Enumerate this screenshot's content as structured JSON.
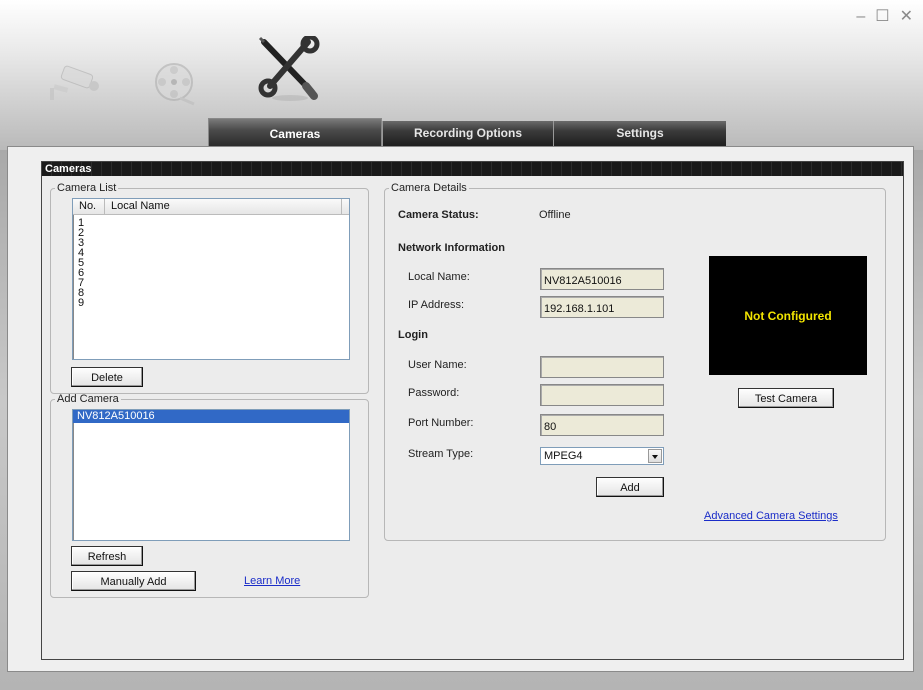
{
  "window": {
    "controls": {
      "minimize": "–",
      "maximize": "☐",
      "close": "✕"
    }
  },
  "mode_icons": [
    "camera-icon",
    "film-reel-icon",
    "tools-icon"
  ],
  "tabs": [
    {
      "label": "Cameras",
      "active": true
    },
    {
      "label": "Recording Options",
      "active": false
    },
    {
      "label": "Settings",
      "active": false
    }
  ],
  "panel": {
    "title": "Cameras"
  },
  "camera_list": {
    "legend": "Camera List",
    "columns": [
      "No.",
      "Local Name"
    ],
    "rows": [
      "1",
      "2",
      "3",
      "4",
      "5",
      "6",
      "7",
      "8",
      "9"
    ],
    "delete_label": "Delete"
  },
  "add_camera": {
    "legend": "Add Camera",
    "items": [
      "NV812A510016"
    ],
    "refresh_label": "Refresh",
    "manual_add_label": "Manually Add",
    "learn_more_label": "Learn More"
  },
  "details": {
    "legend": "Camera Details",
    "status_label": "Camera Status:",
    "status_value": "Offline",
    "network_heading": "Network Information",
    "local_name_label": "Local Name:",
    "local_name_value": "NV812A510016",
    "ip_label": "IP Address:",
    "ip_value": "192.168.1.101",
    "login_heading": "Login",
    "user_label": "User Name:",
    "user_value": "",
    "password_label": "Password:",
    "password_value": "",
    "port_label": "Port Number:",
    "port_value": "80",
    "stream_label": "Stream Type:",
    "stream_value": "MPEG4",
    "add_label": "Add",
    "preview_text": "Not Configured",
    "test_label": "Test Camera",
    "advanced_label": "Advanced Camera Settings"
  }
}
